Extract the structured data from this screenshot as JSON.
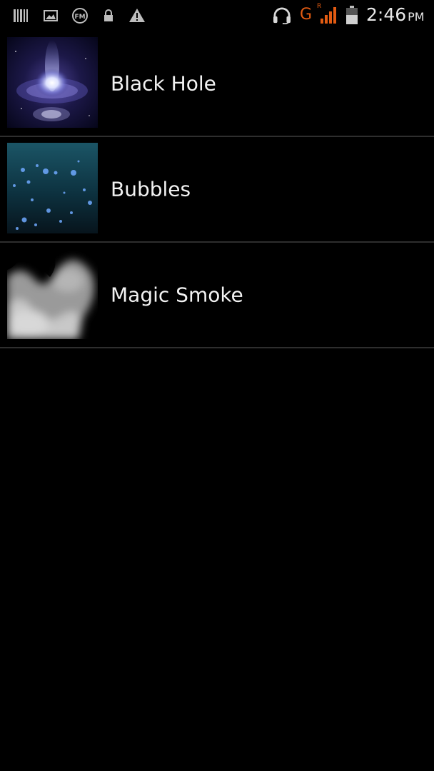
{
  "status_bar": {
    "time": "2:46",
    "ampm": "PM",
    "network_type": "G",
    "roaming_indicator": "R",
    "icons": [
      "barcode-icon",
      "gallery-icon",
      "fm-radio-icon",
      "lock-icon",
      "warning-icon",
      "headset-icon",
      "signal-icon",
      "battery-icon"
    ],
    "network_color": "#e25b12"
  },
  "wallpapers": {
    "items": [
      {
        "label": "Black Hole",
        "thumbnail": "black-hole-thumbnail"
      },
      {
        "label": "Bubbles",
        "thumbnail": "bubbles-thumbnail"
      },
      {
        "label": "Magic Smoke",
        "thumbnail": "magic-smoke-thumbnail"
      }
    ]
  },
  "colors": {
    "background": "#000000",
    "divider": "#2e2e2e",
    "text": "#f2f2f2"
  }
}
